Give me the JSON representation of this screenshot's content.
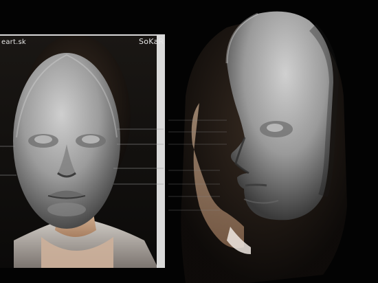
{
  "left_panel": {
    "caption_left": "eart.sk",
    "caption_right": "SoKaR"
  },
  "description": {
    "left_view": "front-mask-icon",
    "right_view": "profile-mask-icon"
  }
}
